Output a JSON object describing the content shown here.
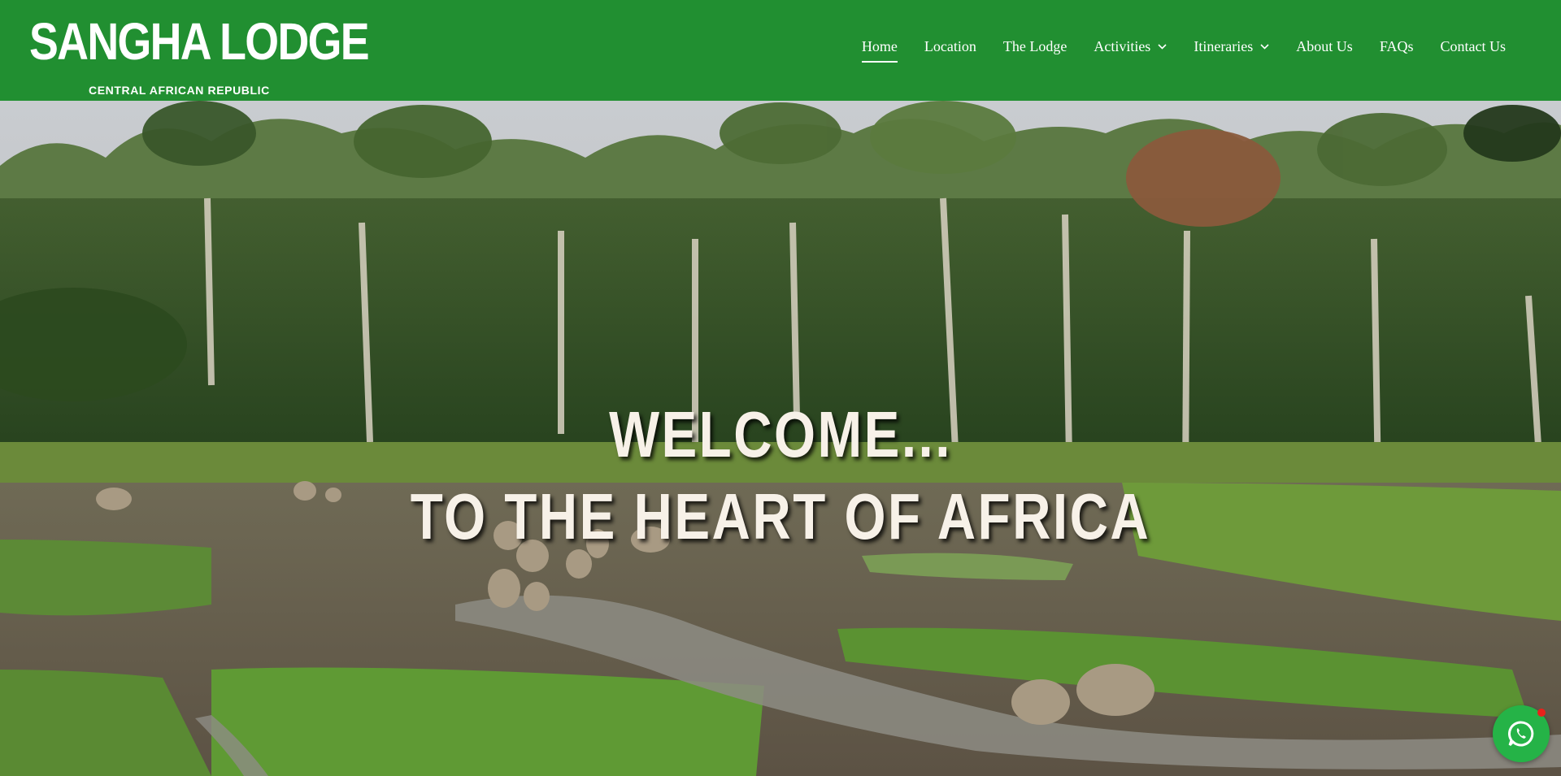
{
  "brand": {
    "name": "SANGHA LODGE",
    "tagline": "CENTRAL AFRICAN REPUBLIC",
    "header_color": "#218f31"
  },
  "nav": {
    "items": [
      {
        "label": "Home",
        "active": true,
        "has_dropdown": false
      },
      {
        "label": "Location",
        "active": false,
        "has_dropdown": false
      },
      {
        "label": "The Lodge",
        "active": false,
        "has_dropdown": false
      },
      {
        "label": "Activities",
        "active": false,
        "has_dropdown": true
      },
      {
        "label": "Itineraries",
        "active": false,
        "has_dropdown": true
      },
      {
        "label": "About Us",
        "active": false,
        "has_dropdown": false
      },
      {
        "label": "FAQs",
        "active": false,
        "has_dropdown": false
      },
      {
        "label": "Contact Us",
        "active": false,
        "has_dropdown": false
      }
    ]
  },
  "hero": {
    "line1": "WELCOME...",
    "line2": "TO THE HEART OF AFRICA",
    "image_subject": "forest elephants in a forest clearing"
  },
  "chat": {
    "icon": "whatsapp-icon",
    "badge_color": "#e8221b",
    "button_color": "#25b347"
  }
}
